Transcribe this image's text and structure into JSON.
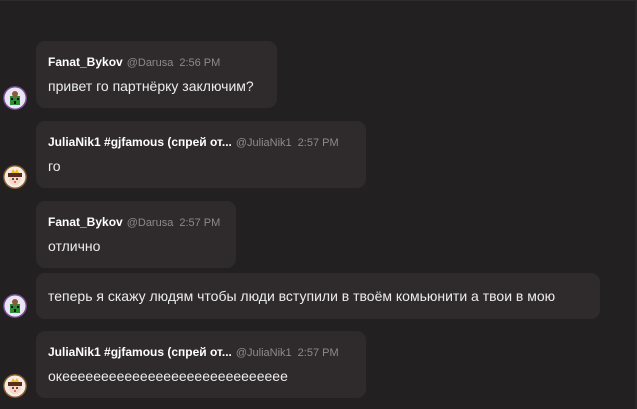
{
  "messages": [
    {
      "author": "Fanat_Bykov",
      "handle": "@Darusa",
      "time": "2:56 PM",
      "text": "привет го партнёрку заключим?",
      "avatar_icon": "creeper-bear-avatar-icon"
    },
    {
      "author": "JuliaNik1 #gjfamous (спрей от...",
      "handle": "@JuliaNik1",
      "time": "2:57 PM",
      "text": "го",
      "avatar_icon": "girl-crown-avatar-icon"
    },
    {
      "author": "Fanat_Bykov",
      "handle": "@Darusa",
      "time": "2:57 PM",
      "text": "отлично"
    },
    {
      "text": "теперь я скажу людям чтобы люди вступили в твоём комьюнити а твои в мою",
      "avatar_icon": "creeper-bear-avatar-icon"
    },
    {
      "author": "JuliaNik1 #gjfamous (спрей от...",
      "handle": "@JuliaNik1",
      "time": "2:57 PM",
      "text": "океееееееееееееееееееееееееееее",
      "avatar_icon": "girl-crown-avatar-icon"
    }
  ],
  "colors": {
    "background": "#232021",
    "bubble": "#2f2b2c",
    "author": "#ffffff",
    "meta": "#8e8a8b",
    "text": "#ececec"
  }
}
